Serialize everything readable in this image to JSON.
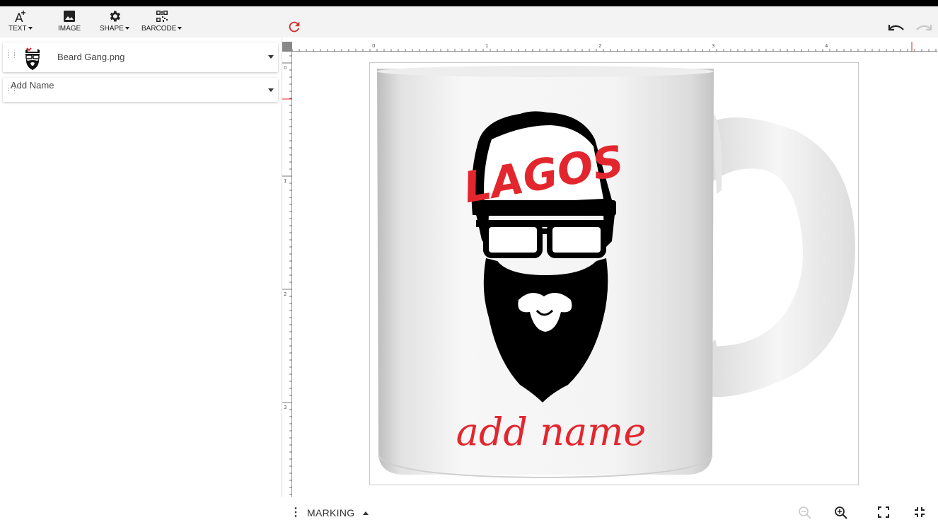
{
  "toolbar": {
    "text_label": "TEXT",
    "image_label": "IMAGE",
    "shape_label": "SHAPE",
    "barcode_label": "BARCODE",
    "refresh_icon": "refresh-icon",
    "undo_icon": "undo-icon",
    "redo_icon": "redo-icon",
    "accent_color": "#d32f2f"
  },
  "layers": [
    {
      "name": "Beard Gang.png",
      "icon": "beard-gang-thumbnail"
    },
    {
      "name": "Add Name",
      "icon": "text-layer"
    }
  ],
  "ruler": {
    "horizontal_marks": [
      "0",
      "1",
      "2",
      "3",
      "4"
    ],
    "vertical_marks": [
      "0",
      "1",
      "2",
      "3"
    ]
  },
  "design": {
    "cap_text": "LAGOS",
    "name_text": "add name",
    "print_color": "#e3262e",
    "ink_color": "#000000"
  },
  "bottom": {
    "marking_label": "MARKING",
    "icons": [
      "zoom-out-icon",
      "zoom-in-icon",
      "fullscreen-icon",
      "exit-fullscreen-icon"
    ]
  }
}
